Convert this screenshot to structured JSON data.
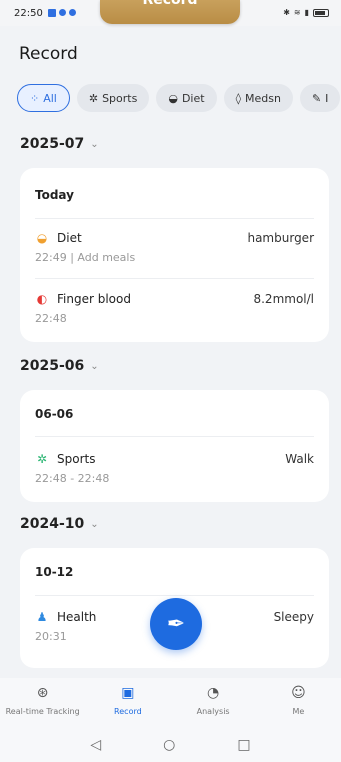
{
  "status_bar": {
    "time": "22:50"
  },
  "overlay_tab": {
    "label": "Record"
  },
  "page": {
    "title": "Record"
  },
  "filters": [
    {
      "label": "All",
      "active": true,
      "icon": "dots-icon"
    },
    {
      "label": "Sports",
      "active": false,
      "icon": "sports-icon"
    },
    {
      "label": "Diet",
      "active": false,
      "icon": "diet-icon"
    },
    {
      "label": "Medsn",
      "active": false,
      "icon": "medicine-icon"
    },
    {
      "label": "I",
      "active": false,
      "icon": "other-icon"
    }
  ],
  "sections": [
    {
      "month": "2025-07",
      "date": "Today",
      "entries": [
        {
          "title": "Diet",
          "value": "hamburger",
          "sub": "22:49 | Add meals",
          "icon": "diet-icon",
          "color": "#f0a030"
        },
        {
          "title": "Finger blood",
          "value": "8.2mmol/l",
          "sub": "22:48",
          "icon": "blood-drop-icon",
          "color": "#e53935"
        }
      ]
    },
    {
      "month": "2025-06",
      "date": "06-06",
      "entries": [
        {
          "title": "Sports",
          "value": "Walk",
          "sub": "22:48 - 22:48",
          "icon": "sports-icon",
          "color": "#2bb673"
        }
      ]
    },
    {
      "month": "2024-10",
      "date": "10-12",
      "entries": [
        {
          "title": "Health",
          "value": "Sleepy",
          "sub": "20:31",
          "icon": "person-icon",
          "color": "#2f8ae0"
        }
      ]
    }
  ],
  "bottom_nav": [
    {
      "label": "Real-time Tracking",
      "icon": "tracking-icon",
      "active": false
    },
    {
      "label": "Record",
      "icon": "record-icon",
      "active": true
    },
    {
      "label": "Analysis",
      "icon": "analysis-icon",
      "active": false
    },
    {
      "label": "Me",
      "icon": "me-icon",
      "active": false
    }
  ],
  "colors": {
    "accent": "#1e6be0",
    "background": "#f1f3f6",
    "overlay": "#c39a52"
  }
}
